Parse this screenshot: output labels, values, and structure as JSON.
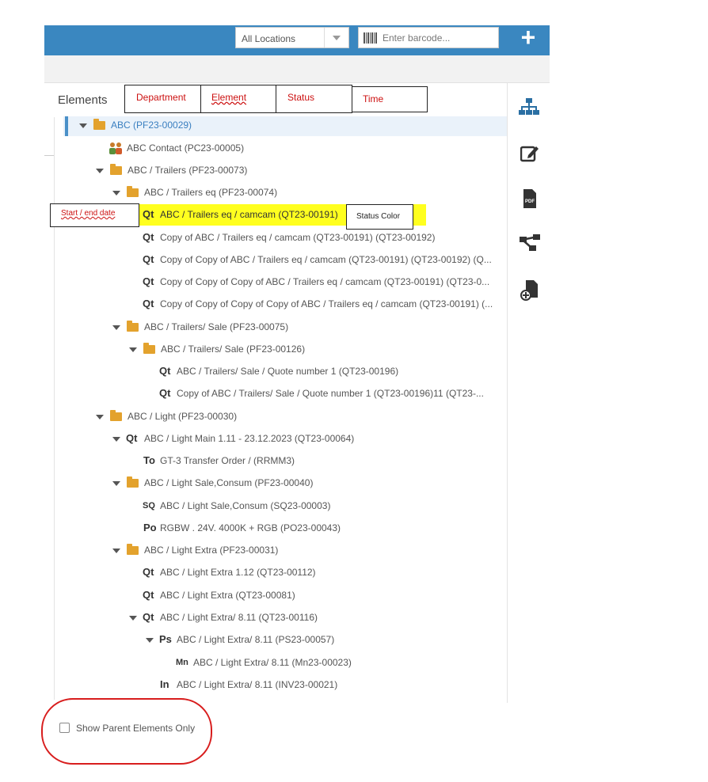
{
  "header": {
    "location_select": "All Locations",
    "barcode_placeholder": "Enter barcode...",
    "plus_label": "+"
  },
  "panel": {
    "title": "Elements"
  },
  "annotations": {
    "columns": [
      "Department",
      "Element",
      "Status",
      "Time"
    ],
    "start_end_date": "Start / end date",
    "status_color": "Status Color"
  },
  "tree": [
    {
      "tag": "",
      "label": "ABC (PF23-00029)"
    },
    {
      "tag": "",
      "label": "ABC Contact (PC23-00005)"
    },
    {
      "tag": "",
      "label": "ABC / Trailers (PF23-00073)"
    },
    {
      "tag": "",
      "label": "ABC / Trailers eq (PF23-00074)"
    },
    {
      "tag": "Qt",
      "label": "ABC / Trailers eq / camcam (QT23-00191)"
    },
    {
      "tag": "Qt",
      "label": "Copy of ABC / Trailers eq / camcam (QT23-00191) (QT23-00192)"
    },
    {
      "tag": "Qt",
      "label": "Copy of Copy of ABC / Trailers eq / camcam (QT23-00191) (QT23-00192) (Q..."
    },
    {
      "tag": "Qt",
      "label": "Copy of Copy of Copy of ABC / Trailers eq / camcam (QT23-00191) (QT23-0..."
    },
    {
      "tag": "Qt",
      "label": "Copy of Copy of Copy of Copy of ABC / Trailers eq / camcam (QT23-00191) (..."
    },
    {
      "tag": "",
      "label": "ABC / Trailers/ Sale (PF23-00075)"
    },
    {
      "tag": "",
      "label": "ABC / Trailers/ Sale (PF23-00126)"
    },
    {
      "tag": "Qt",
      "label": "ABC / Trailers/ Sale / Quote number 1 (QT23-00196)"
    },
    {
      "tag": "Qt",
      "label": "Copy of ABC / Trailers/ Sale / Quote number 1 (QT23-00196)11 (QT23-..."
    },
    {
      "tag": "",
      "label": "ABC / Light (PF23-00030)"
    },
    {
      "tag": "Qt",
      "label": "ABC / Light Main 1.11 - 23.12.2023 (QT23-00064)"
    },
    {
      "tag": "To",
      "label": "GT-3 Transfer Order / (RRMM3)"
    },
    {
      "tag": "",
      "label": "ABC / Light Sale,Consum (PF23-00040)"
    },
    {
      "tag": "SQ",
      "label": "ABC / Light Sale,Consum (SQ23-00003)"
    },
    {
      "tag": "Po",
      "label": "RGBW . 24V. 4000K + RGB (PO23-00043)"
    },
    {
      "tag": "",
      "label": "ABC / Light Extra (PF23-00031)"
    },
    {
      "tag": "Qt",
      "label": "ABC / Light Extra 1.12 (QT23-00112)"
    },
    {
      "tag": "Qt",
      "label": "ABC / Light Extra (QT23-00081)"
    },
    {
      "tag": "Qt",
      "label": "ABC / Light Extra/ 8.11 (QT23-00116)"
    },
    {
      "tag": "Ps",
      "label": "ABC / Light Extra/ 8.11 (PS23-00057)"
    },
    {
      "tag": "Mn",
      "label": "ABC / Light Extra/ 8.11 (Mn23-00023)"
    },
    {
      "tag": "In",
      "label": "ABC / Light Extra/ 8.11 (INV23-00021)"
    }
  ],
  "footer": {
    "show_parent_label": "Show Parent Elements Only"
  },
  "colors": {
    "topbar": "#3a87c0",
    "highlight": "#ffff1f",
    "annotation_text": "#cc1010",
    "folder": "#e3a22d"
  }
}
